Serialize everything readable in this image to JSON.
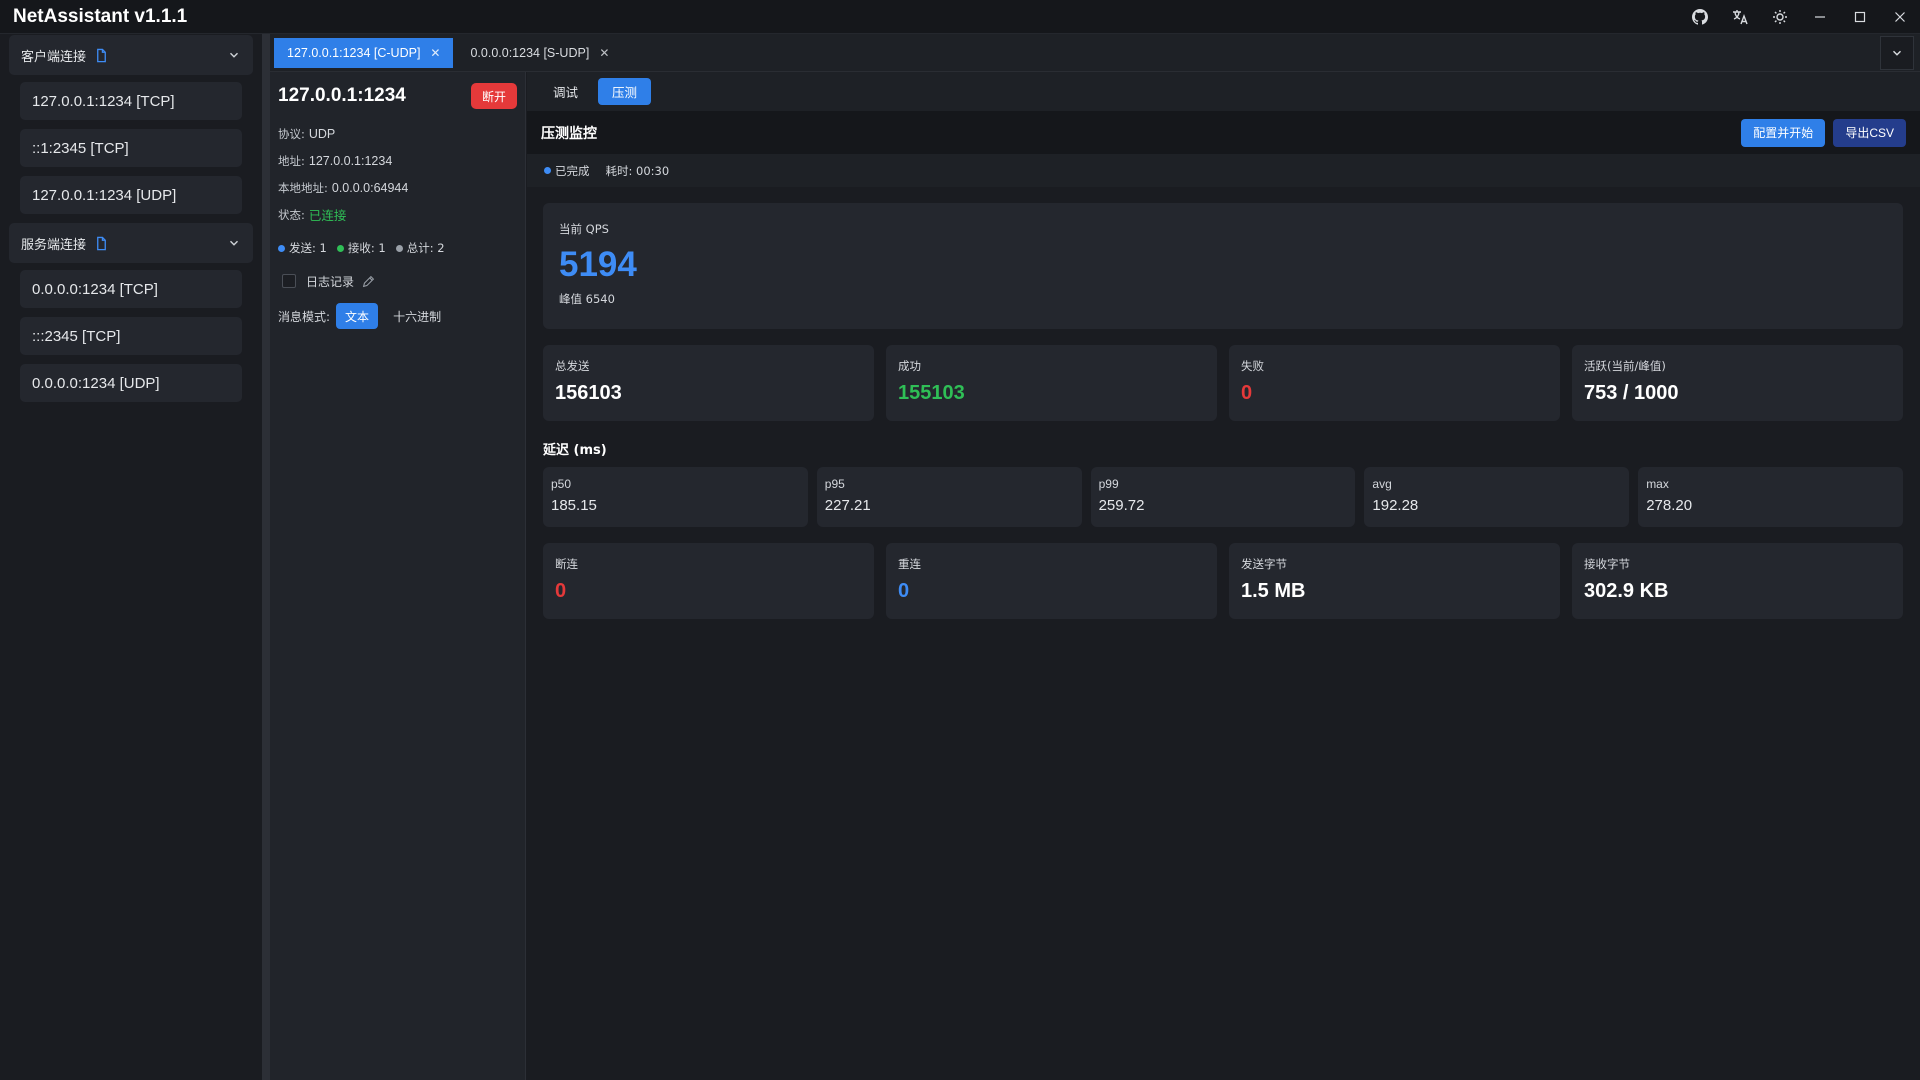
{
  "app": {
    "title": "NetAssistant v1.1.1"
  },
  "window_controls": [
    "github-icon",
    "translate-icon",
    "theme-icon",
    "minimize-icon",
    "maximize-icon",
    "close-icon"
  ],
  "sidebar": {
    "client_group": {
      "label": "客户端连接",
      "items": [
        "127.0.0.1:1234 [TCP]",
        "::1:2345 [TCP]",
        "127.0.0.1:1234 [UDP]"
      ]
    },
    "server_group": {
      "label": "服务端连接",
      "items": [
        "0.0.0.0:1234 [TCP]",
        ":::2345 [TCP]",
        "0.0.0.0:1234 [UDP]"
      ]
    }
  },
  "tabs": [
    {
      "label": "127.0.0.1:1234 [C-UDP]",
      "active": true
    },
    {
      "label": "0.0.0.0:1234 [S-UDP]",
      "active": false
    }
  ],
  "detail": {
    "title": "127.0.0.1:1234",
    "disconnect_label": "断开",
    "protocol_key": "协议:",
    "protocol": "UDP",
    "address_key": "地址:",
    "address": "127.0.0.1:1234",
    "local_key": "本地地址:",
    "local": "0.0.0.0:64944",
    "status_key": "状态:",
    "status": "已连接",
    "sent": "发送: 1",
    "recv": "接收: 1",
    "total": "总计: 2",
    "log_label": "日志记录",
    "mode_label": "消息模式:",
    "mode_text": "文本",
    "mode_hex": "十六进制"
  },
  "main": {
    "subtabs": [
      "调试",
      "压测"
    ],
    "monitor_title": "压测监控",
    "configure_start": "配置并开始",
    "export_csv": "导出CSV",
    "status_done": "已完成",
    "elapsed": "耗时: 00:30",
    "qps_label": "当前 QPS",
    "qps_value": "5194",
    "qps_peak": "峰值 6540",
    "metrics": [
      {
        "label": "总发送",
        "value": "156103"
      },
      {
        "label": "成功",
        "value": "155103"
      },
      {
        "label": "失败",
        "value": "0"
      },
      {
        "label": "活跃(当前/峰值)",
        "value": "753 / 1000"
      }
    ],
    "latency_title": "延迟 (ms)",
    "latency": [
      {
        "label": "p50",
        "value": "185.15"
      },
      {
        "label": "p95",
        "value": "227.21"
      },
      {
        "label": "p99",
        "value": "259.72"
      },
      {
        "label": "avg",
        "value": "192.28"
      },
      {
        "label": "max",
        "value": "278.20"
      }
    ],
    "bottom": [
      {
        "label": "断连",
        "value": "0"
      },
      {
        "label": "重连",
        "value": "0"
      },
      {
        "label": "发送字节",
        "value": "1.5 MB"
      },
      {
        "label": "接收字节",
        "value": "302.9 KB"
      }
    ]
  },
  "colors": {
    "accent": "#2f7fe8",
    "success": "#2fbf56",
    "danger": "#e5393a",
    "panel": "#24272e"
  }
}
